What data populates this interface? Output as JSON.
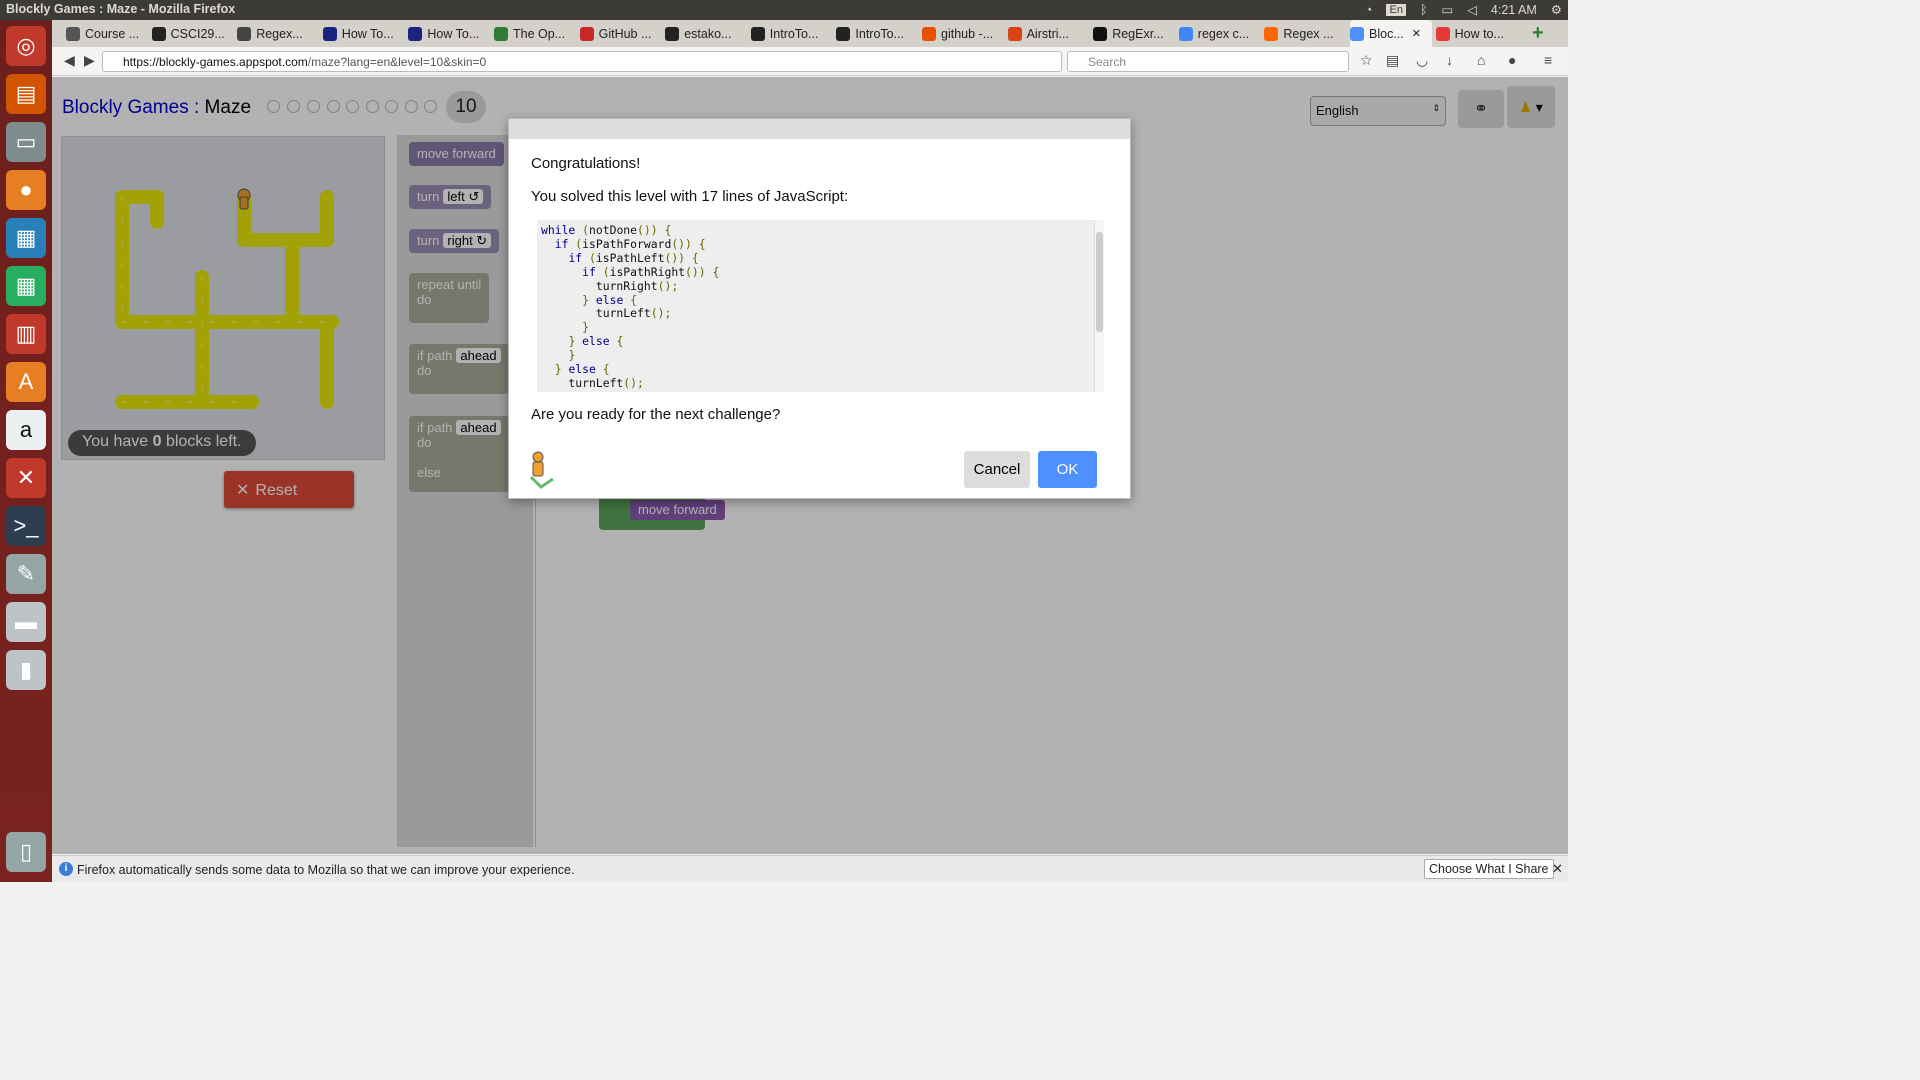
{
  "os": {
    "window_title": "Blockly Games : Maze - Mozilla Firefox",
    "keyboard": "En",
    "clock": "4:21 AM"
  },
  "launcher": {
    "items": [
      "ubuntu-icon",
      "files-icon",
      "firefox-icon",
      "writer-icon",
      "calc-icon",
      "impress-icon",
      "software-center-icon",
      "amazon-icon",
      "settings-icon",
      "terminal-icon",
      "text-editor-icon",
      "disk-icon",
      "usb-icon",
      "trash-icon"
    ]
  },
  "tabs": [
    {
      "label": "Course ...",
      "color": "#555"
    },
    {
      "label": "CSCI29...",
      "color": "#222"
    },
    {
      "label": "Regex...",
      "color": "#444"
    },
    {
      "label": "How To...",
      "color": "#1a237e"
    },
    {
      "label": "How To...",
      "color": "#1a237e"
    },
    {
      "label": "The Op...",
      "color": "#2e7d32"
    },
    {
      "label": "GitHub ...",
      "color": "#c62828"
    },
    {
      "label": "estako...",
      "color": "#222"
    },
    {
      "label": "IntroTo...",
      "color": "#222"
    },
    {
      "label": "IntroTo...",
      "color": "#222"
    },
    {
      "label": "github -...",
      "color": "#e65100"
    },
    {
      "label": "Airstri...",
      "color": "#d84315"
    },
    {
      "label": "RegExr...",
      "color": "#111"
    },
    {
      "label": "regex c...",
      "color": "#4285f4"
    },
    {
      "label": "Regex ...",
      "color": "#ff6600"
    },
    {
      "label": "Bloc...",
      "color": "#4d90fe"
    },
    {
      "label": "How to...",
      "color": "#e53935"
    }
  ],
  "navbar": {
    "url_host": "https://blockly-games.appspot.com",
    "url_path": "/maze?lang=en&level=10&skin=0",
    "search_placeholder": "Search"
  },
  "page": {
    "site": "Blockly Games",
    "sep": " : ",
    "game": "Maze",
    "level": "10",
    "language": "English",
    "blocks_left_pre": "You have ",
    "blocks_left_num": "0",
    "blocks_left_post": " blocks left.",
    "reset": "Reset"
  },
  "toolbox": {
    "move_forward": "move forward",
    "turn": "turn",
    "left": "left ↺",
    "right": "right ↻",
    "repeat_until": "repeat until",
    "do": "do",
    "if_path": "if path",
    "ahead": "ahead",
    "else": "else"
  },
  "workspace": {
    "block": "move forward"
  },
  "dialog": {
    "congrats": "Congratulations!",
    "solved": "You solved this level with 17 lines of JavaScript:",
    "code": "while (notDone()) {\n  if (isPathForward()) {\n    if (isPathLeft()) {\n      if (isPathRight()) {\n        turnRight();\n      } else {\n        turnLeft();\n      }\n    } else {\n    }\n  } else {\n    turnLeft();",
    "ready": "Are you ready for the next challenge?",
    "cancel": "Cancel",
    "ok": "OK"
  },
  "notice": {
    "text": "Firefox automatically sends some data to Mozilla so that we can improve your experience.",
    "button": "Choose What I Share"
  }
}
